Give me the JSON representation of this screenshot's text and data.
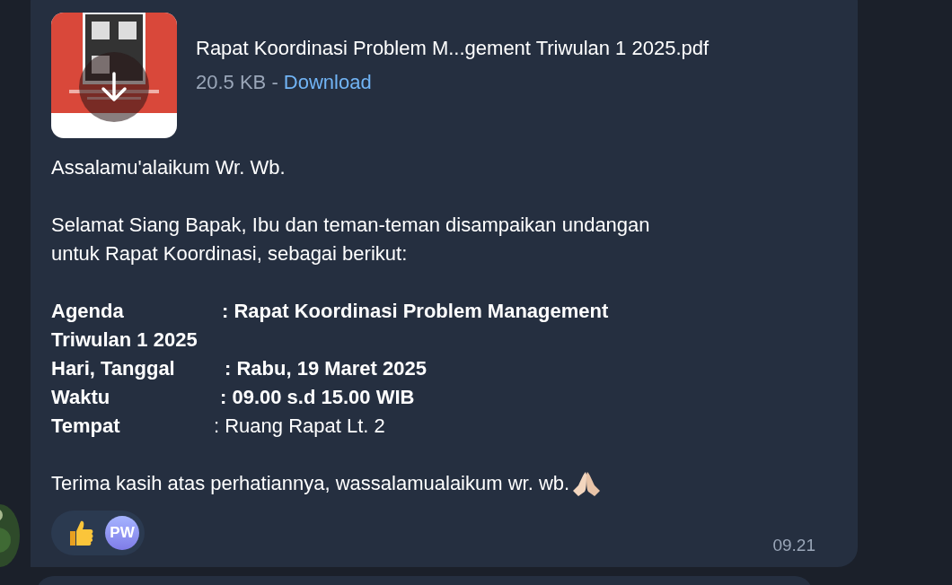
{
  "message": {
    "file": {
      "name": "Rapat Koordinasi Problem M...gement Triwulan 1 2025.pdf",
      "size": "20.5 KB",
      "separator": "-",
      "action": "Download"
    },
    "greeting": "Assalamu'alaikum Wr. Wb.",
    "intro": "Selamat Siang Bapak, Ibu dan teman-teman disampaikan undangan untuk Rapat Koordinasi, sebagai berikut:",
    "details": [
      {
        "label": "Agenda",
        "value": ": Rapat Koordinasi Problem Management Triwulan 1 2025",
        "value_bold": true
      },
      {
        "label": "Hari, Tanggal",
        "value": ": Rabu, 19 Maret 2025",
        "value_bold": true
      },
      {
        "label": "Waktu",
        "value": ": 09.00 s.d 15.00 WIB",
        "value_bold": true
      },
      {
        "label": "Tempat",
        "value": ": Ruang Rapat Lt. 2",
        "value_bold": false
      }
    ],
    "closing": "Terima kasih atas perhatiannya, wassalamualaikum wr. wb.",
    "reactions": [
      {
        "reactor": "PW"
      }
    ],
    "time": "09.21"
  }
}
